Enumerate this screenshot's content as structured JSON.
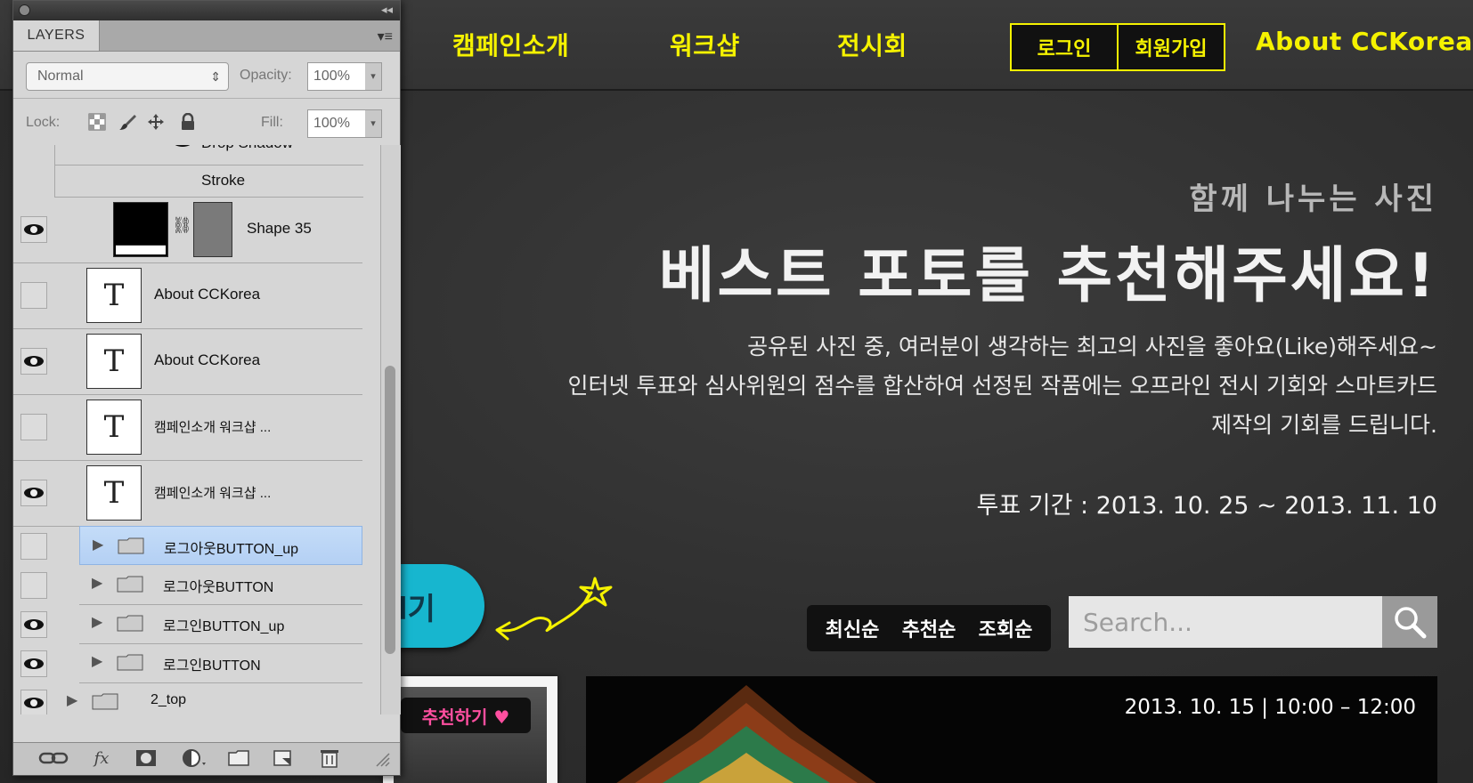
{
  "site": {
    "nav": {
      "campaign": "캠페인소개",
      "workshop": "워크샵",
      "exhibition": "전시회",
      "login": "로그인",
      "signup": "회원가입",
      "about": "About CCKorea"
    },
    "hero": {
      "subtitle": "함께 나누는 사진",
      "title": "베스트 포토를 추천해주세요!",
      "desc_line1": "공유된 사진 중, 여러분이 생각하는 최고의 사진을 좋아요(Like)해주세요~",
      "desc_line2": "인터넷 투표와 심사위원의 점수를 합산하여 선정된 작품에는 오프라인 전시 기회와 스마트카드",
      "desc_line3": "제작의 기회를 드립니다.",
      "period": "투표 기간 : 2013. 10. 25 ~ 2013. 11. 10"
    },
    "cta_label": "l기",
    "sort": [
      "최신순",
      "추천순",
      "조회순"
    ],
    "search": {
      "placeholder": "Search..."
    },
    "recommend_tag": "추천하기 ♥",
    "card_date": "2013. 10. 15  |  10:00 – 12:00",
    "colors": {
      "accent": "#f5f200",
      "cta": "#17b6cf",
      "tag_pink": "#ff4fa0"
    }
  },
  "layers_panel": {
    "tab": "LAYERS",
    "blend_mode": "Normal",
    "opacity_label": "Opacity:",
    "opacity": "100%",
    "lock_label": "Lock:",
    "fill_label": "Fill:",
    "fill": "100%",
    "effects": [
      "Drop Shadow",
      "Stroke"
    ],
    "layers": [
      {
        "name": "Shape 35",
        "visible": true
      },
      {
        "name": "About CCKorea",
        "visible": false
      },
      {
        "name": "About CCKorea",
        "visible": true
      },
      {
        "name": "캠페인소개        워크샵 ...",
        "visible": false
      },
      {
        "name": "캠페인소개        워크샵 ...",
        "visible": true
      },
      {
        "name": "로그아웃BUTTON_up",
        "visible": false,
        "selected": true
      },
      {
        "name": "로그아웃BUTTON",
        "visible": false
      },
      {
        "name": "로그인BUTTON_up",
        "visible": true
      },
      {
        "name": "로그인BUTTON",
        "visible": true
      },
      {
        "name": "2_top",
        "visible": true
      }
    ],
    "footer_icons": [
      "link-icon",
      "fx-icon",
      "mask-icon",
      "adjustment-icon",
      "group-folder-icon",
      "new-layer-icon",
      "trash-icon"
    ],
    "fx_label": "fx"
  }
}
